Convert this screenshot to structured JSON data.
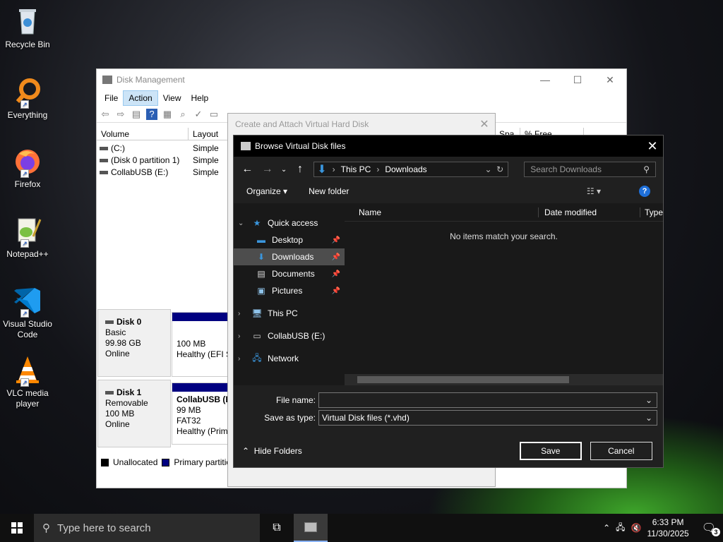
{
  "desktop": {
    "icons": [
      {
        "label": "Recycle Bin",
        "icon": "recycle-bin-icon"
      },
      {
        "label": "Everything",
        "icon": "everything-search-icon"
      },
      {
        "label": "Firefox",
        "icon": "firefox-icon"
      },
      {
        "label": "Notepad++",
        "icon": "notepad-plus-plus-icon"
      },
      {
        "label": "Visual Studio Code",
        "icon": "vscode-icon"
      },
      {
        "label": "VLC media player",
        "icon": "vlc-icon"
      }
    ]
  },
  "disk_management": {
    "title": "Disk Management",
    "menu": [
      "File",
      "Action",
      "View",
      "Help"
    ],
    "active_menu": "Action",
    "columns": [
      "Volume",
      "Layout"
    ],
    "columns_extra": [
      "Spa",
      "% Free"
    ],
    "volumes": [
      {
        "name": "(C:)",
        "layout": "Simple"
      },
      {
        "name": "(Disk 0 partition 1)",
        "layout": "Simple"
      },
      {
        "name": "CollabUSB (E:)",
        "layout": "Simple"
      }
    ],
    "disks": [
      {
        "name": "Disk 0",
        "type": "Basic",
        "size": "99.98 GB",
        "status": "Online",
        "partition": {
          "title": "",
          "line1": "100 MB",
          "line2": "Healthy (EFI S"
        }
      },
      {
        "name": "Disk 1",
        "type": "Removable",
        "size": "100 MB",
        "status": "Online",
        "partition": {
          "title": "CollabUSB  (E",
          "line1": "99 MB FAT32",
          "line2": "Healthy (Prim"
        }
      }
    ],
    "legend": [
      {
        "label": "Unallocated",
        "color": "#000000"
      },
      {
        "label": "Primary partition",
        "color": "#000080"
      }
    ]
  },
  "create_attach_dialog": {
    "title": "Create and Attach Virtual Hard Disk"
  },
  "browse_dialog": {
    "title": "Browse Virtual Disk files",
    "breadcrumb": [
      "This PC",
      "Downloads"
    ],
    "search_placeholder": "Search Downloads",
    "organize_label": "Organize",
    "new_folder_label": "New folder",
    "nav": [
      {
        "label": "Quick access",
        "icon": "star-icon",
        "expanded": true
      },
      {
        "label": "Desktop",
        "icon": "desktop-folder-icon",
        "pinned": true
      },
      {
        "label": "Downloads",
        "icon": "downloads-folder-icon",
        "pinned": true,
        "selected": true
      },
      {
        "label": "Documents",
        "icon": "documents-folder-icon",
        "pinned": true
      },
      {
        "label": "Pictures",
        "icon": "pictures-folder-icon",
        "pinned": true
      },
      {
        "label": "This PC",
        "icon": "this-pc-icon"
      },
      {
        "label": "CollabUSB (E:)",
        "icon": "usb-drive-icon"
      },
      {
        "label": "Network",
        "icon": "network-icon"
      }
    ],
    "columns": [
      "Name",
      "Date modified",
      "Type"
    ],
    "empty_message": "No items match your search.",
    "file_name_label": "File name:",
    "file_name_value": "",
    "save_as_type_label": "Save as type:",
    "save_as_type_value": "Virtual Disk files (*.vhd)",
    "hide_folders_label": "Hide Folders",
    "save_label": "Save",
    "cancel_label": "Cancel"
  },
  "taskbar": {
    "search_placeholder": "Type here to search",
    "time": "6:33 PM",
    "date": "11/30/2025",
    "notification_count": "3"
  }
}
